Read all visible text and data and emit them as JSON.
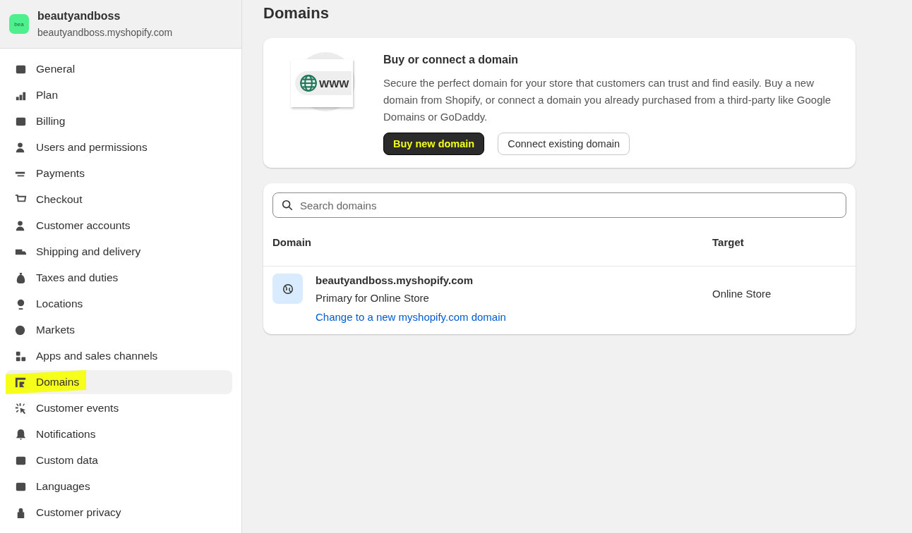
{
  "store": {
    "avatar": "bea",
    "name": "beautyandboss",
    "url": "beautyandboss.myshopify.com"
  },
  "nav": [
    {
      "label": "General",
      "selected": false,
      "highlighted": false
    },
    {
      "label": "Plan",
      "selected": false,
      "highlighted": false
    },
    {
      "label": "Billing",
      "selected": false,
      "highlighted": false
    },
    {
      "label": "Users and permissions",
      "selected": false,
      "highlighted": false
    },
    {
      "label": "Payments",
      "selected": false,
      "highlighted": false
    },
    {
      "label": "Checkout",
      "selected": false,
      "highlighted": false
    },
    {
      "label": "Customer accounts",
      "selected": false,
      "highlighted": false
    },
    {
      "label": "Shipping and delivery",
      "selected": false,
      "highlighted": false
    },
    {
      "label": "Taxes and duties",
      "selected": false,
      "highlighted": false
    },
    {
      "label": "Locations",
      "selected": false,
      "highlighted": false
    },
    {
      "label": "Markets",
      "selected": false,
      "highlighted": false
    },
    {
      "label": "Apps and sales channels",
      "selected": false,
      "highlighted": false
    },
    {
      "label": "Domains",
      "selected": true,
      "highlighted": true
    },
    {
      "label": "Customer events",
      "selected": false,
      "highlighted": false
    },
    {
      "label": "Notifications",
      "selected": false,
      "highlighted": false
    },
    {
      "label": "Custom data",
      "selected": false,
      "highlighted": false
    },
    {
      "label": "Languages",
      "selected": false,
      "highlighted": false
    },
    {
      "label": "Customer privacy",
      "selected": false,
      "highlighted": false
    }
  ],
  "page_title": "Domains",
  "promo": {
    "badge": "WWW",
    "title": "Buy or connect a domain",
    "body": "Secure the perfect domain for your store that customers can trust and find easily. Buy a new domain from Shopify, or connect a domain you already purchased from a third-party like Google Domains or GoDaddy.",
    "buttons": [
      {
        "label": "Buy new domain",
        "kind": "primary",
        "highlighted": true
      },
      {
        "label": "Connect existing domain",
        "kind": "secondary",
        "highlighted": false
      }
    ]
  },
  "search": {
    "placeholder": "Search domains"
  },
  "table": {
    "columns": [
      "Domain",
      "Target"
    ],
    "rows": [
      {
        "domain": "beautyandboss.myshopify.com",
        "note": "Primary for Online Store",
        "link": "Change to a new myshopify.com domain",
        "target": "Online Store"
      }
    ]
  }
}
